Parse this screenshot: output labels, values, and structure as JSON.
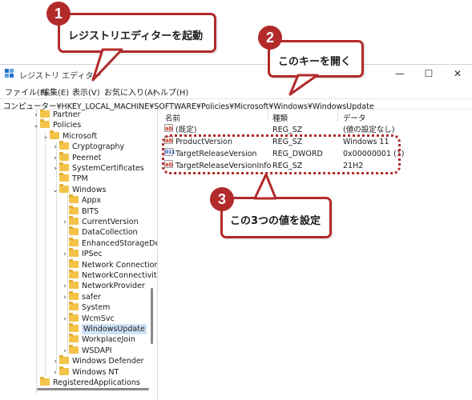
{
  "window": {
    "title": "レジストリ エディター",
    "controls": {
      "minimize": "—",
      "maximize": "☐",
      "close": "✕"
    }
  },
  "menu": [
    "ファイル(F)",
    "編集(E)",
    "表示(V)",
    "お気に入り(A)",
    "ヘルプ(H)"
  ],
  "address": "コンピューター¥HKEY_LOCAL_MACHINE¥SOFTWARE¥Policies¥Microsoft¥Windows¥WindowsUpdate",
  "tree": [
    {
      "label": "Partner",
      "expander": ">"
    },
    {
      "label": "Policies",
      "expander": "v"
    },
    {
      "label": "Microsoft",
      "expander": "v"
    },
    {
      "label": "Cryptography",
      "expander": ">"
    },
    {
      "label": "Peernet",
      "expander": ">"
    },
    {
      "label": "SystemCertificates",
      "expander": ">"
    },
    {
      "label": "TPM",
      "expander": ""
    },
    {
      "label": "Windows",
      "expander": "v"
    },
    {
      "label": "Appx",
      "expander": ""
    },
    {
      "label": "BITS",
      "expander": ""
    },
    {
      "label": "CurrentVersion",
      "expander": ">"
    },
    {
      "label": "DataCollection",
      "expander": ""
    },
    {
      "label": "EnhancedStorageDe",
      "expander": ""
    },
    {
      "label": "IPSec",
      "expander": ">"
    },
    {
      "label": "Network Connection",
      "expander": ""
    },
    {
      "label": "NetworkConnectivit",
      "expander": ""
    },
    {
      "label": "NetworkProvider",
      "expander": ">"
    },
    {
      "label": "safer",
      "expander": ">"
    },
    {
      "label": "System",
      "expander": ""
    },
    {
      "label": "WcmSvc",
      "expander": ">"
    },
    {
      "label": "WindowsUpdate",
      "expander": "",
      "selected": true
    },
    {
      "label": "WorkplaceJoin",
      "expander": ""
    },
    {
      "label": "WSDAPI",
      "expander": ">"
    },
    {
      "label": "Windows Defender",
      "expander": ">"
    },
    {
      "label": "Windows NT",
      "expander": ">"
    },
    {
      "label": "RegisteredApplications",
      "expander": ""
    }
  ],
  "list": {
    "headers": {
      "name": "名前",
      "type": "種類",
      "data": "データ"
    },
    "rows": [
      {
        "icon": "ab",
        "name": "(既定)",
        "type": "REG_SZ",
        "data": "(値の設定なし)"
      },
      {
        "icon": "ab",
        "name": "ProductVersion",
        "type": "REG_SZ",
        "data": "Windows 11"
      },
      {
        "icon": "011",
        "name": "TargetReleaseVersion",
        "type": "REG_DWORD",
        "data": "0x00000001 (1)"
      },
      {
        "icon": "ab",
        "name": "TargetReleaseVersionInfo",
        "type": "REG_SZ",
        "data": "21H2"
      }
    ]
  },
  "callouts": [
    {
      "number": "1",
      "text": "レジストリエディターを起動"
    },
    {
      "number": "2",
      "text": "このキーを開く"
    },
    {
      "number": "3",
      "text": "この3つの値を設定"
    }
  ],
  "colors": {
    "accent": "#b22a2a",
    "folder": "#f3c448",
    "selection": "#cfe3f7"
  }
}
